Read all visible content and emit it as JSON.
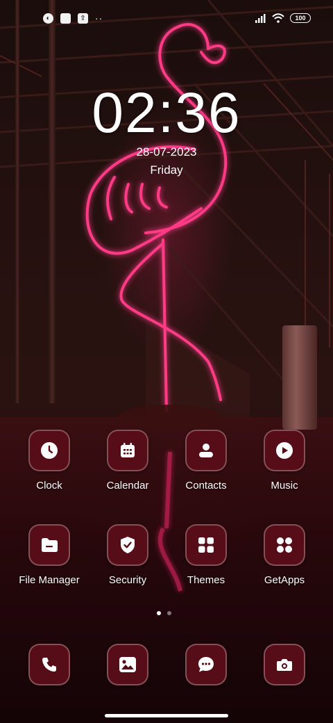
{
  "status_bar": {
    "left_icons": [
      "app-notification-icon",
      "gallery-notification-icon",
      "upload-notification-icon"
    ],
    "more_indicator": "··",
    "battery_level": "100"
  },
  "clock": {
    "time": "02:36",
    "date": "28-07-2023",
    "day": "Friday"
  },
  "apps": {
    "row1": [
      {
        "label": "Clock",
        "icon": "clock-icon"
      },
      {
        "label": "Calendar",
        "icon": "calendar-icon"
      },
      {
        "label": "Contacts",
        "icon": "contacts-icon"
      },
      {
        "label": "Music",
        "icon": "music-play-icon"
      }
    ],
    "row2": [
      {
        "label": "File Manager",
        "icon": "folder-icon"
      },
      {
        "label": "Security",
        "icon": "shield-check-icon"
      },
      {
        "label": "Themes",
        "icon": "grid-icon"
      },
      {
        "label": "GetApps",
        "icon": "apps-grid-icon"
      }
    ]
  },
  "dock": [
    {
      "icon": "phone-icon"
    },
    {
      "icon": "gallery-icon"
    },
    {
      "icon": "messages-icon"
    },
    {
      "icon": "camera-icon"
    }
  ],
  "pager": {
    "pages": 2,
    "active": 1
  },
  "colors": {
    "icon_bg": "#560d17",
    "neon_pink": "#ff3a86"
  }
}
